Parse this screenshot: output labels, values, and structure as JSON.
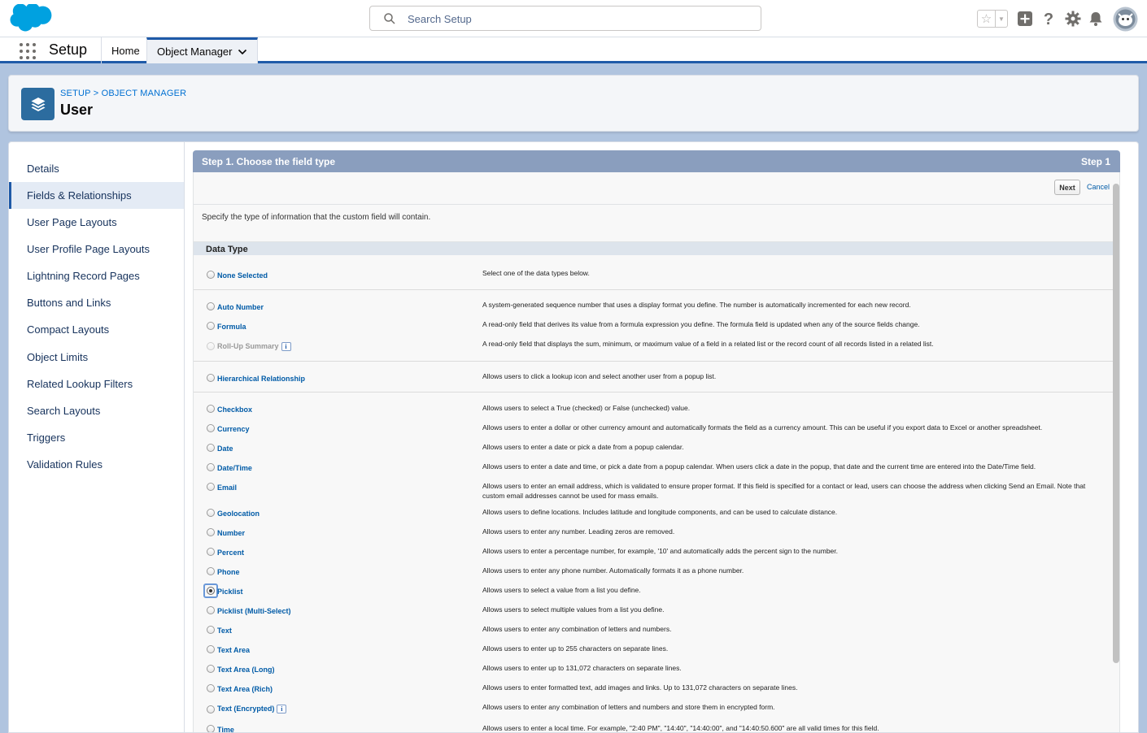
{
  "header": {
    "search_placeholder": "Search Setup"
  },
  "nav": {
    "app_name": "Setup",
    "tabs": [
      {
        "label": "Home"
      },
      {
        "label": "Object Manager"
      }
    ]
  },
  "page": {
    "breadcrumb_setup": "SETUP",
    "breadcrumb_sep": " > ",
    "breadcrumb_obj": "OBJECT MANAGER",
    "title": "User"
  },
  "sidebar": {
    "items": [
      {
        "label": "Details"
      },
      {
        "label": "Fields & Relationships"
      },
      {
        "label": "User Page Layouts"
      },
      {
        "label": "User Profile Page Layouts"
      },
      {
        "label": "Lightning Record Pages"
      },
      {
        "label": "Buttons and Links"
      },
      {
        "label": "Compact Layouts"
      },
      {
        "label": "Object Limits"
      },
      {
        "label": "Related Lookup Filters"
      },
      {
        "label": "Search Layouts"
      },
      {
        "label": "Triggers"
      },
      {
        "label": "Validation Rules"
      }
    ]
  },
  "step": {
    "title": "Step 1. Choose the field type",
    "number": "Step 1",
    "next_label": "Next",
    "cancel_label": "Cancel",
    "instruction": "Specify the type of information that the custom field will contain.",
    "section_title": "Data Type"
  },
  "data_types": [
    {
      "label": "None Selected",
      "desc": "Select one of the data types below."
    },
    {
      "label": "Auto Number",
      "desc": "A system-generated sequence number that uses a display format you define. The number is automatically incremented for each new record."
    },
    {
      "label": "Formula",
      "desc": "A read-only field that derives its value from a formula expression you define. The formula field is updated when any of the source fields change."
    },
    {
      "label": "Roll-Up Summary",
      "desc": "A read-only field that displays the sum, minimum, or maximum value of a field in a related list or the record count of all records listed in a related list."
    },
    {
      "label": "Hierarchical Relationship",
      "desc": "Allows users to click a lookup icon and select another user from a popup list."
    },
    {
      "label": "Checkbox",
      "desc": "Allows users to select a True (checked) or False (unchecked) value."
    },
    {
      "label": "Currency",
      "desc": "Allows users to enter a dollar or other currency amount and automatically formats the field as a currency amount. This can be useful if you export data to Excel or another spreadsheet."
    },
    {
      "label": "Date",
      "desc": "Allows users to enter a date or pick a date from a popup calendar."
    },
    {
      "label": "Date/Time",
      "desc": "Allows users to enter a date and time, or pick a date from a popup calendar. When users click a date in the popup, that date and the current time are entered into the Date/Time field."
    },
    {
      "label": "Email",
      "desc": "Allows users to enter an email address, which is validated to ensure proper format. If this field is specified for a contact or lead, users can choose the address when clicking Send an Email. Note that custom email addresses cannot be used for mass emails."
    },
    {
      "label": "Geolocation",
      "desc": "Allows users to define locations. Includes latitude and longitude components, and can be used to calculate distance."
    },
    {
      "label": "Number",
      "desc": "Allows users to enter any number. Leading zeros are removed."
    },
    {
      "label": "Percent",
      "desc": "Allows users to enter a percentage number, for example, '10' and automatically adds the percent sign to the number."
    },
    {
      "label": "Phone",
      "desc": "Allows users to enter any phone number. Automatically formats it as a phone number."
    },
    {
      "label": "Picklist",
      "desc": "Allows users to select a value from a list you define."
    },
    {
      "label": "Picklist (Multi-Select)",
      "desc": "Allows users to select multiple values from a list you define."
    },
    {
      "label": "Text",
      "desc": "Allows users to enter any combination of letters and numbers."
    },
    {
      "label": "Text Area",
      "desc": "Allows users to enter up to 255 characters on separate lines."
    },
    {
      "label": "Text Area (Long)",
      "desc": "Allows users to enter up to 131,072 characters on separate lines."
    },
    {
      "label": "Text Area (Rich)",
      "desc": "Allows users to enter formatted text, add images and links. Up to 131,072 characters on separate lines."
    },
    {
      "label": "Text (Encrypted)",
      "desc": "Allows users to enter any combination of letters and numbers and store them in encrypted form."
    },
    {
      "label": "Time",
      "desc": "Allows users to enter a local time. For example, \"2:40 PM\", \"14:40\", \"14:40:00\", and \"14:40:50.600\" are all valid times for this field."
    }
  ],
  "selected_type": "Picklist",
  "colors": {
    "brand": "#00a1e0",
    "nav_accent": "#1f5aa8",
    "link": "#015ba7",
    "step_bar": "#8a9ebe"
  }
}
